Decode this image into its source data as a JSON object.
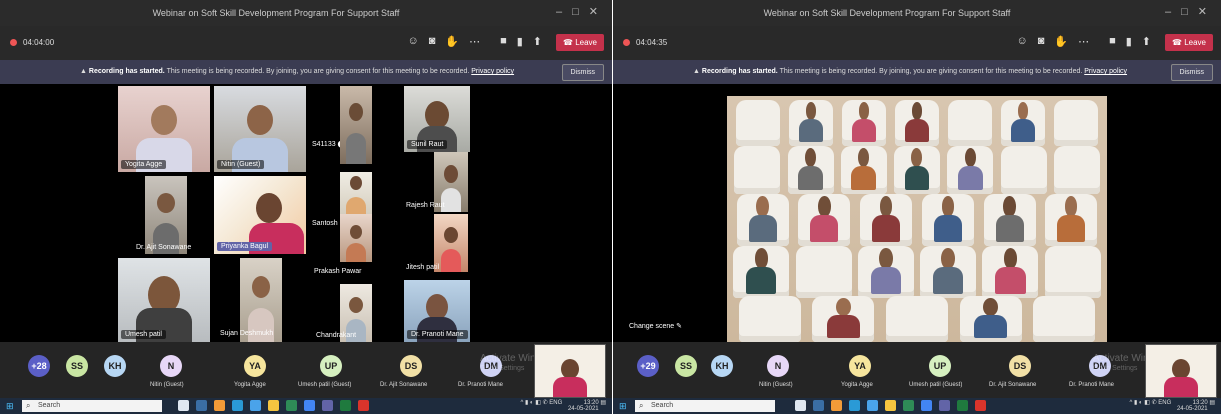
{
  "left": {
    "window_title": "Webinar on Soft Skill Development Program For Support Staff",
    "timer": "04:04:00",
    "banner": {
      "bold": "Recording has started.",
      "text": "This meeting is being recorded. By joining, you are giving consent for this meeting to be recorded.",
      "link": "Privacy policy",
      "dismiss": "Dismiss"
    },
    "leave_label": "Leave",
    "tiles": [
      {
        "name": "Yogita Agge"
      },
      {
        "name": "Nitin (Guest)"
      },
      {
        "name": "Dr. Ajit Sonawane"
      },
      {
        "name": "Priyanka Bagul"
      },
      {
        "name": "Sujan Deshmukh"
      },
      {
        "name": "Sunil Raut"
      },
      {
        "name": "Santosh Shinde"
      },
      {
        "name": "Rajesh Raut"
      },
      {
        "name": "Jitesh patil"
      },
      {
        "name": "Chandrakant"
      },
      {
        "name": "Dr. Pranoti Mane"
      },
      {
        "name": "Prakash Pawar"
      },
      {
        "name": "Umesh patil"
      }
    ],
    "roster": [
      {
        "initials": "+28",
        "name": ""
      },
      {
        "initials": "SS",
        "name": ""
      },
      {
        "initials": "KH",
        "name": ""
      },
      {
        "initials": "N",
        "name": "Nitin (Guest)"
      },
      {
        "initials": "YA",
        "name": "Yogita Agge"
      },
      {
        "initials": "UP",
        "name": "Umesh patil (Guest)"
      },
      {
        "initials": "DS",
        "name": "Dr. Ajit Sonawane"
      },
      {
        "initials": "DM",
        "name": "Dr. Pranoti Mane"
      }
    ],
    "watermark": [
      "Activate Win",
      "Go to Settings"
    ],
    "search": "Search",
    "clock": {
      "time": "13:20",
      "date": "24-05-2021",
      "lang": "ENG"
    }
  },
  "right": {
    "window_title": "Webinar on Soft Skill Development Program For Support Staff",
    "timer": "04:04:35",
    "banner": {
      "bold": "Recording has started.",
      "text": "This meeting is being recorded. By joining, you are giving consent for this meeting to be recorded.",
      "link": "Privacy policy",
      "dismiss": "Dismiss"
    },
    "leave_label": "Leave",
    "change_scene": "Change scene",
    "roster": [
      {
        "initials": "+29",
        "name": ""
      },
      {
        "initials": "SS",
        "name": ""
      },
      {
        "initials": "KH",
        "name": ""
      },
      {
        "initials": "N",
        "name": "Nitin (Guest)"
      },
      {
        "initials": "YA",
        "name": "Yogita Agge"
      },
      {
        "initials": "UP",
        "name": "Umesh patil (Guest)"
      },
      {
        "initials": "DS",
        "name": "Dr. Ajit Sonawane"
      },
      {
        "initials": "DM",
        "name": "Dr. Pranoti Mane"
      }
    ],
    "watermark": [
      "Activate Win",
      "Go to Settings"
    ],
    "search": "Search",
    "clock": {
      "time": "13:20",
      "date": "24-05-2021",
      "lang": "ENG"
    }
  },
  "colors": {
    "leave": "#c4314b",
    "banner": "#3b3c52",
    "avatar_colors": [
      "#5b5fc7",
      "#c9e6a3",
      "#b7d7f4",
      "#e7d7f7",
      "#f6e59d",
      "#d6f0c0",
      "#f1e0a6",
      "#cfd3f5"
    ]
  }
}
